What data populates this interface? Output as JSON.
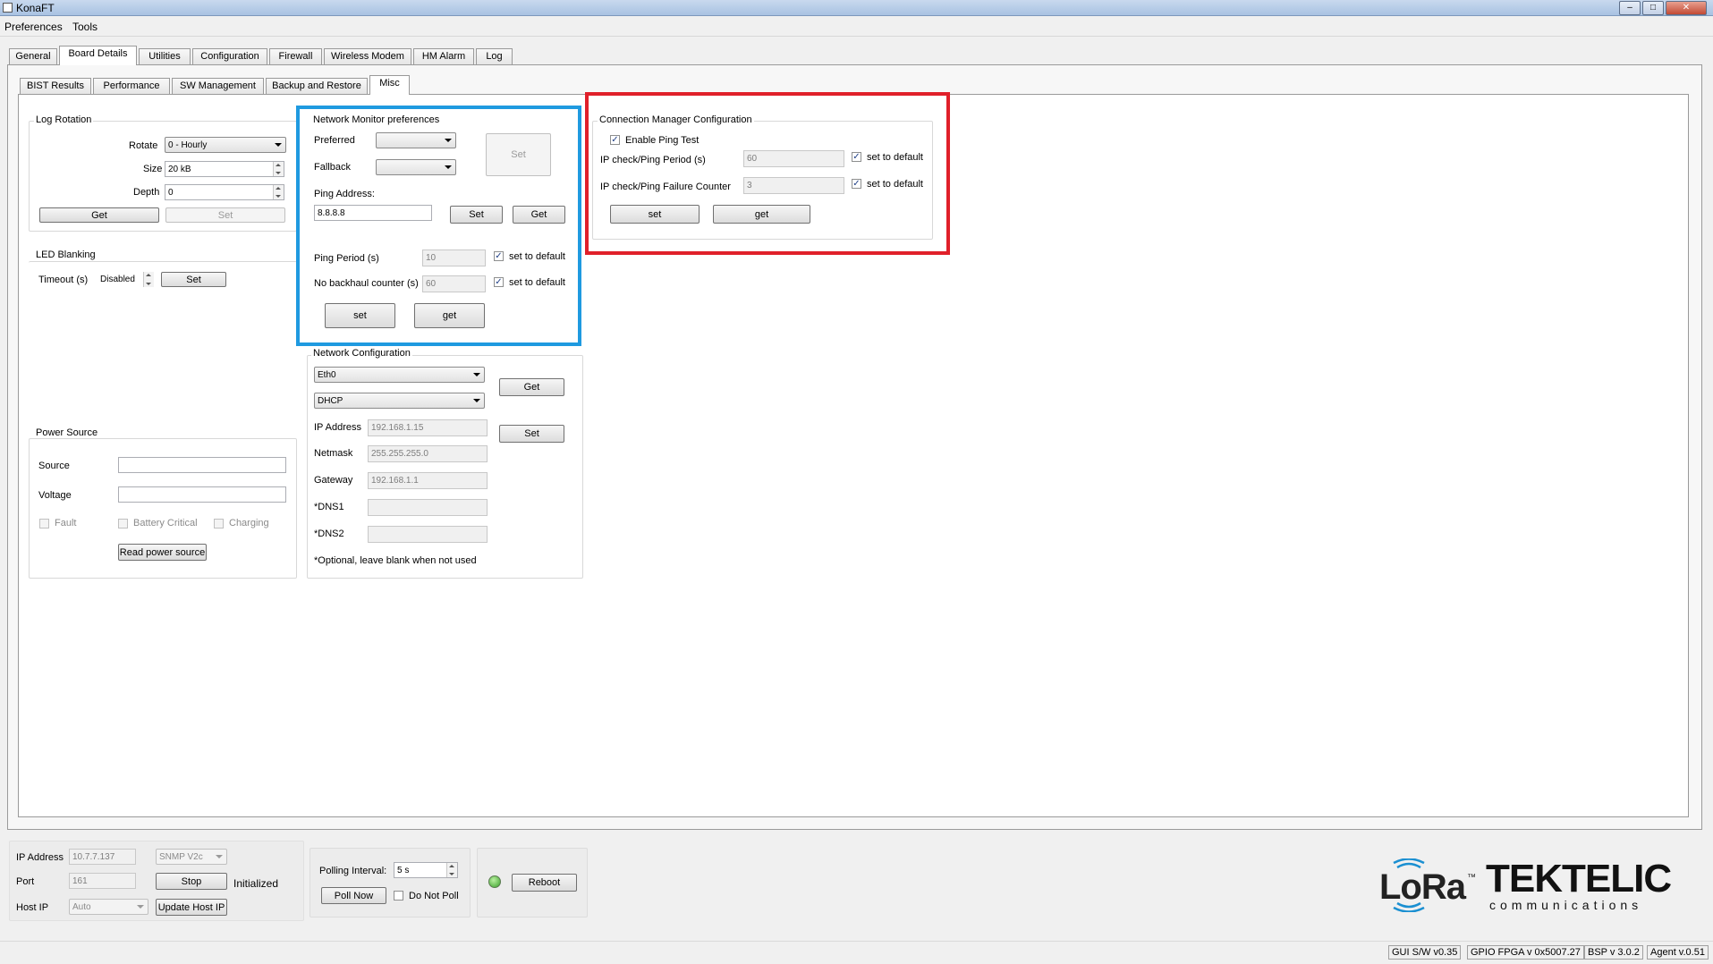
{
  "window": {
    "title": "KonaFT",
    "min": "–",
    "max": "□",
    "close": "✕"
  },
  "menu": {
    "preferences": "Preferences",
    "tools": "Tools"
  },
  "main_tabs": [
    "General",
    "Board Details",
    "Utilities",
    "Configuration",
    "Firewall",
    "Wireless Modem",
    "HM Alarm",
    "Log"
  ],
  "sub_tabs": [
    "BIST Results",
    "Performance",
    "SW Management",
    "Backup and Restore",
    "Misc"
  ],
  "log_rotation": {
    "title": "Log Rotation",
    "rotate_label": "Rotate",
    "rotate_value": "0 - Hourly",
    "size_label": "Size",
    "size_value": "20 kB",
    "depth_label": "Depth",
    "depth_value": "0",
    "get": "Get",
    "set": "Set"
  },
  "led_blanking": {
    "title": "LED Blanking",
    "timeout_label": "Timeout (s)",
    "timeout_value": "Disabled",
    "set": "Set"
  },
  "power_source": {
    "title": "Power Source",
    "source_label": "Source",
    "voltage_label": "Voltage",
    "fault": "Fault",
    "battery_critical": "Battery Critical",
    "charging": "Charging",
    "read": "Read power source"
  },
  "network_monitor": {
    "title": "Network Monitor preferences",
    "preferred_label": "Preferred",
    "fallback_label": "Fallback",
    "set_big": "Set",
    "ping_address_label": "Ping Address:",
    "ping_address": "8.8.8.8",
    "set": "Set",
    "get": "Get",
    "ping_period_label": "Ping Period (s)",
    "ping_period": "10",
    "no_backhaul_label": "No backhaul counter (s)",
    "no_backhaul": "60",
    "set_default": "set to default",
    "set_lower": "set",
    "get_lower": "get"
  },
  "network_config": {
    "title": "Network Configuration",
    "interface": "Eth0",
    "mode": "DHCP",
    "get": "Get",
    "set": "Set",
    "ip_label": "IP Address",
    "ip": "192.168.1.15",
    "netmask_label": "Netmask",
    "netmask": "255.255.255.0",
    "gateway_label": "Gateway",
    "gateway": "192.168.1.1",
    "dns1_label": "*DNS1",
    "dns2_label": "*DNS2",
    "note": "*Optional, leave blank when not used"
  },
  "conn_manager": {
    "title": "Connection Manager Configuration",
    "enable_label": "Enable  Ping Test",
    "period_label": "IP check/Ping Period (s)",
    "period": "60",
    "failure_label": "IP check/Ping Failure Counter",
    "failure": "3",
    "set_default": "set to default",
    "set": "set",
    "get": "get"
  },
  "bottom": {
    "ip_label": "IP Address",
    "ip": "10.7.7.137",
    "snmp": "SNMP V2c",
    "port_label": "Port",
    "port": "161",
    "stop": "Stop",
    "initialized": "Initialized",
    "host_ip_label": "Host IP",
    "host_ip": "Auto",
    "update_host_ip": "Update Host IP",
    "polling_label": "Polling Interval:",
    "polling_value": "5 s",
    "poll_now": "Poll Now",
    "do_not_poll": "Do Not Poll",
    "reboot": "Reboot"
  },
  "logos": {
    "lora": "LoRa",
    "tm": "™",
    "tektelic": "TEKTELIC",
    "communications": "communications"
  },
  "status": {
    "gui": "GUI S/W v0.35",
    "fpga": "GPIO FPGA v 0x5007.27",
    "bsp": "BSP v 3.0.2",
    "agent": "Agent v.0.51"
  },
  "colors": {
    "highlight_blue": "#1f9ae0",
    "highlight_red": "#e0202a",
    "lora_blue": "#1a8fd1"
  }
}
